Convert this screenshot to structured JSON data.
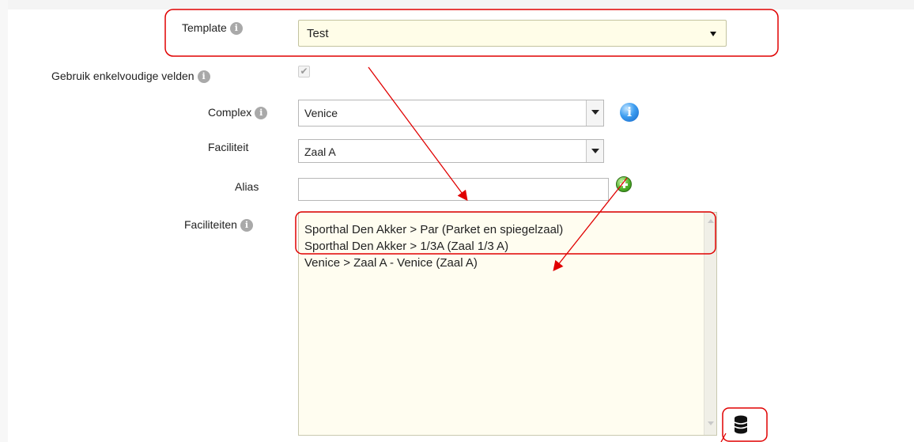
{
  "form": {
    "template": {
      "label": "Template",
      "value": "Test"
    },
    "simple_fields": {
      "label": "Gebruik enkelvoudige velden",
      "checked": true
    },
    "complex": {
      "label": "Complex",
      "value": "Venice"
    },
    "facility": {
      "label": "Faciliteit",
      "value": "Zaal A"
    },
    "alias": {
      "label": "Alias",
      "value": ""
    },
    "facilities": {
      "label": "Faciliteiten",
      "items": [
        "Sporthal Den Akker > Par (Parket en spiegelzaal)",
        "Sporthal Den Akker > 1/3A (Zaal 1/3 A)",
        "Venice > Zaal A - Venice (Zaal A)"
      ]
    }
  },
  "icons": {
    "info": "info-icon",
    "blue_info": "blue-info-icon",
    "add": "green-add-icon",
    "database": "database-icon",
    "checkmark": "✔",
    "info_glyph": "i"
  },
  "colors": {
    "annotation": "#e00000",
    "field_highlight": "#fffde8",
    "list_background": "#fffdf0"
  }
}
